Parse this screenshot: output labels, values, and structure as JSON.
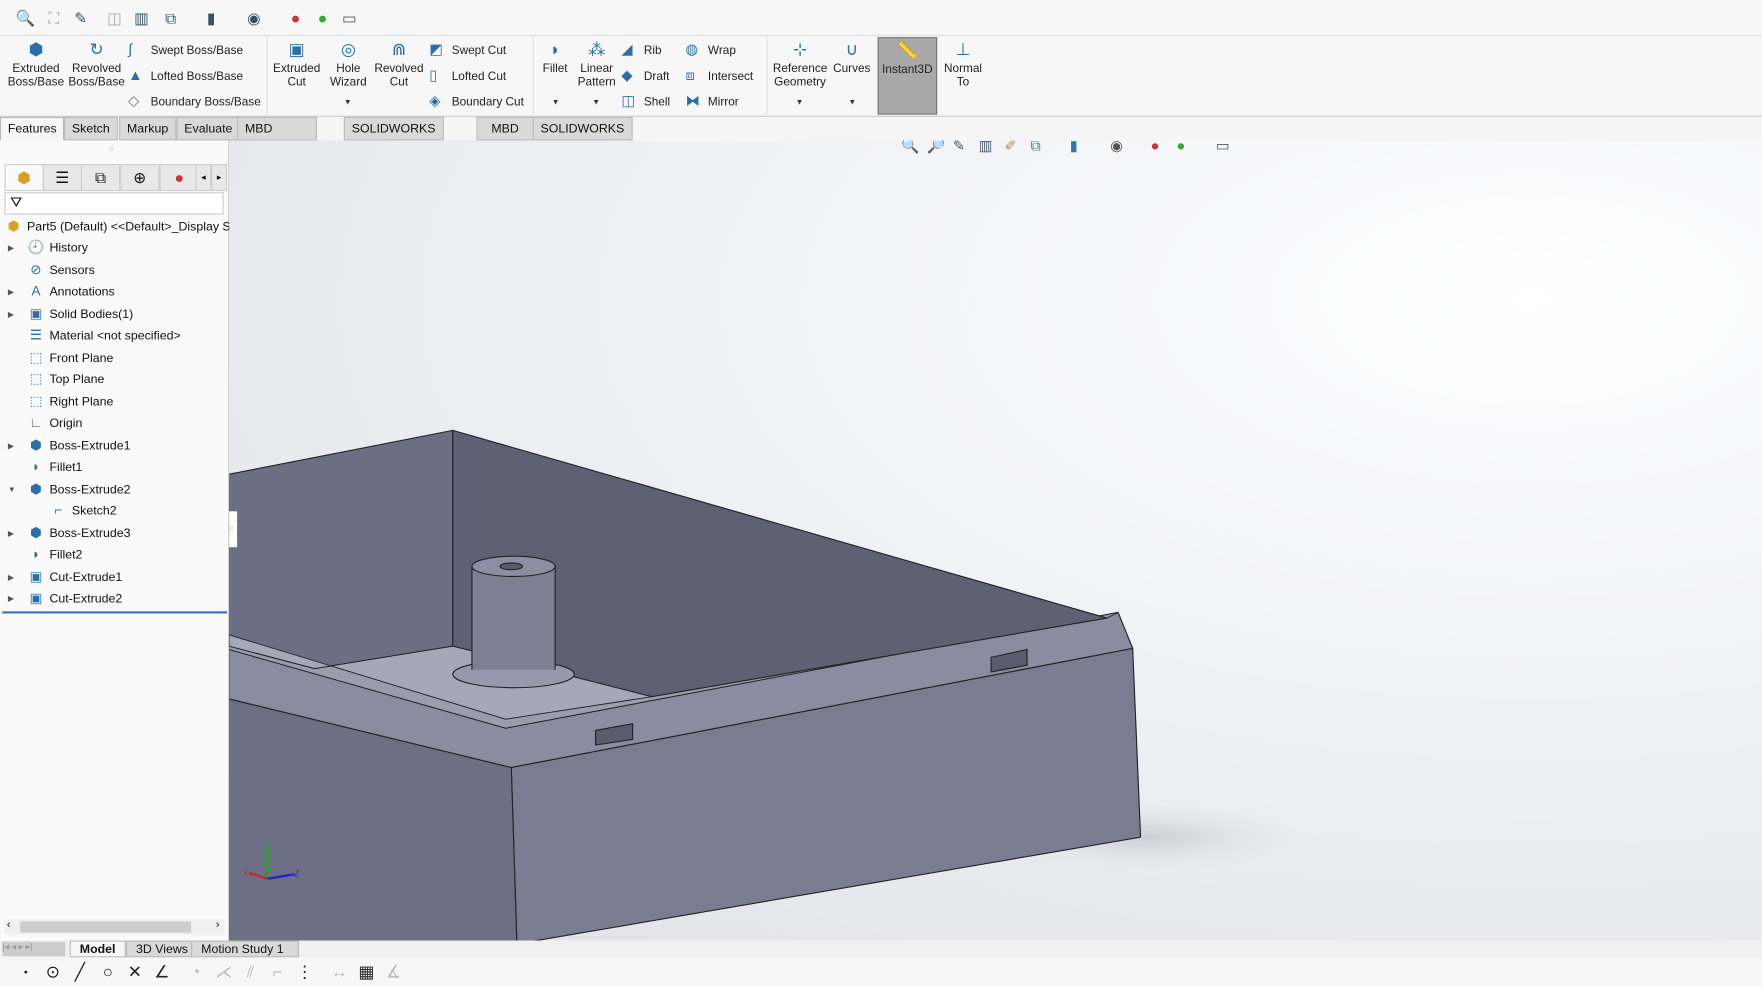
{
  "ribbon": {
    "extruded_boss": "Extruded Boss/Base",
    "revolved_boss": "Revolved Boss/Base",
    "swept_boss": "Swept Boss/Base",
    "lofted_boss": "Lofted Boss/Base",
    "boundary_boss": "Boundary Boss/Base",
    "extruded_cut": "Extruded Cut",
    "hole_wizard": "Hole Wizard",
    "revolved_cut": "Revolved Cut",
    "swept_cut": "Swept Cut",
    "lofted_cut": "Lofted Cut",
    "boundary_cut": "Boundary Cut",
    "fillet": "Fillet",
    "linear_pattern": "Linear Pattern",
    "rib": "Rib",
    "draft": "Draft",
    "shell": "Shell",
    "wrap": "Wrap",
    "intersect": "Intersect",
    "mirror": "Mirror",
    "reference_geometry": "Reference Geometry",
    "curves": "Curves",
    "instant3d": "Instant3D",
    "normal_to": "Normal To"
  },
  "tabs": [
    "Features",
    "Sketch",
    "Markup",
    "Evaluate",
    "MBD Dimensions",
    "SOLIDWORKS Add-Ins",
    "MBD",
    "SOLIDWORKS Inspection"
  ],
  "tree": {
    "root": "Part5 (Default) <<Default>_Display Sta",
    "items": [
      "History",
      "Sensors",
      "Annotations",
      "Solid Bodies(1)",
      "Material <not specified>",
      "Front Plane",
      "Top Plane",
      "Right Plane",
      "Origin",
      "Boss-Extrude1",
      "Fillet1",
      "Boss-Extrude2",
      "Sketch2",
      "Boss-Extrude3",
      "Fillet2",
      "Cut-Extrude1",
      "Cut-Extrude2"
    ]
  },
  "bottom_tabs": [
    "Model",
    "3D Views",
    "Motion Study 1"
  ],
  "triad": {
    "x": "X",
    "y": "Y",
    "z": "Z"
  },
  "colors": {
    "accent": "#2a6fa8",
    "model": "#7a7d92",
    "instant3d_active": "#a8a8a8"
  }
}
